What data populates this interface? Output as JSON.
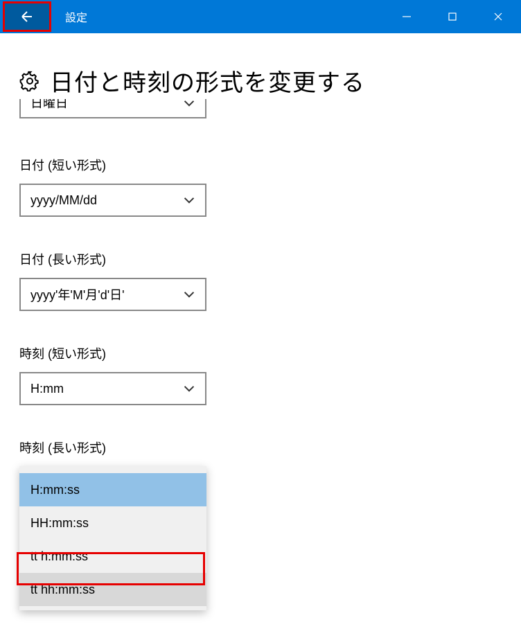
{
  "titlebar": {
    "title": "設定"
  },
  "page": {
    "title": "日付と時刻の形式を変更する"
  },
  "groups": {
    "first_day": {
      "value": "日曜日"
    },
    "short_date": {
      "label": "日付 (短い形式)",
      "value": "yyyy/MM/dd"
    },
    "long_date": {
      "label": "日付 (長い形式)",
      "value": "yyyy'年'M'月'd'日'"
    },
    "short_time": {
      "label": "時刻 (短い形式)",
      "value": "H:mm"
    },
    "long_time": {
      "label": "時刻 (長い形式)",
      "options": {
        "opt1": "H:mm:ss",
        "opt2": "HH:mm:ss",
        "opt3": "tt h:mm:ss",
        "opt4": "tt hh:mm:ss"
      }
    }
  }
}
